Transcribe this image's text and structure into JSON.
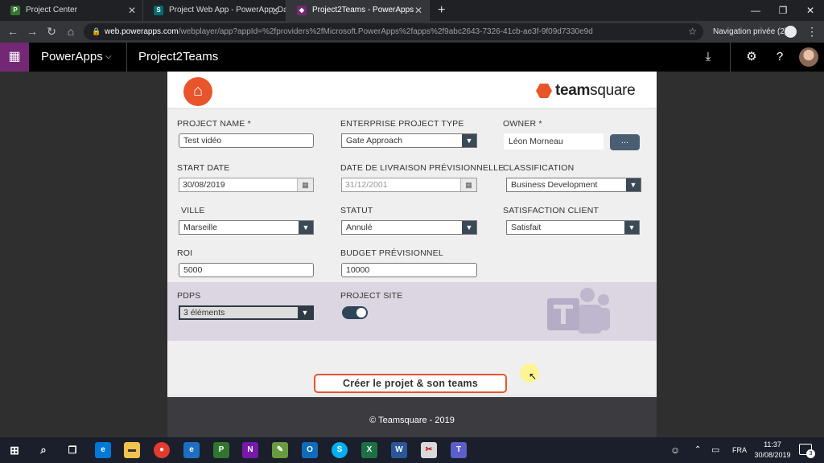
{
  "browser": {
    "tabs": [
      {
        "title": "Project Center",
        "favicon": "P",
        "color": "#31752f",
        "active": false
      },
      {
        "title": "Project Web App - PowerApp_Da",
        "favicon": "S",
        "color": "#036c70",
        "active": false
      },
      {
        "title": "Project2Teams - PowerApps",
        "favicon": "◆",
        "color": "#742774",
        "active": true
      }
    ],
    "url_host": "web.powerapps.com",
    "url_path": "/webplayer/app?appId=%2fproviders%2fMicrosoft.PowerApps%2fapps%2f9abc2643-7326-41cb-ae3f-9f09d7330e9d",
    "incognito_label": "Navigation privée (2)"
  },
  "header": {
    "brand": "PowerApps",
    "app_name": "Project2Teams"
  },
  "form": {
    "logo_brand": "team",
    "logo_brand_light": "square",
    "project_name_label": "PROJECT NAME *",
    "project_name_value": "Test vidéo",
    "ept_label": "ENTERPRISE PROJECT TYPE",
    "ept_value": "Gate Approach",
    "owner_label": "OWNER *",
    "owner_value": "Léon Morneau",
    "owner_btn": "...",
    "start_label": "START DATE",
    "start_value": "30/08/2019",
    "livraison_label": "DATE DE LIVRAISON PRÉVISIONNELLE",
    "livraison_value": "31/12/2001",
    "classification_label": "CLASSIFICATION",
    "classification_value": "Business Development",
    "ville_label": "VILLE",
    "ville_value": "Marseille",
    "statut_label": "STATUT",
    "statut_value": "Annulé",
    "satisfaction_label": "SATISFACTION CLIENT",
    "satisfaction_value": "Satisfait",
    "roi_label": "ROI",
    "roi_value": "5000",
    "budget_label": "BUDGET PRÉVISIONNEL",
    "budget_value": "10000",
    "pdps_label": "PDPS",
    "pdps_value": "3 éléments",
    "project_site_label": "PROJECT SITE",
    "project_site_on": true,
    "create_button": "Créer le projet & son teams",
    "footer": "© Teamsquare - 2019"
  },
  "taskbar": {
    "lang": "FRA",
    "time": "11:37",
    "date": "30/08/2019",
    "notifications": "3"
  }
}
